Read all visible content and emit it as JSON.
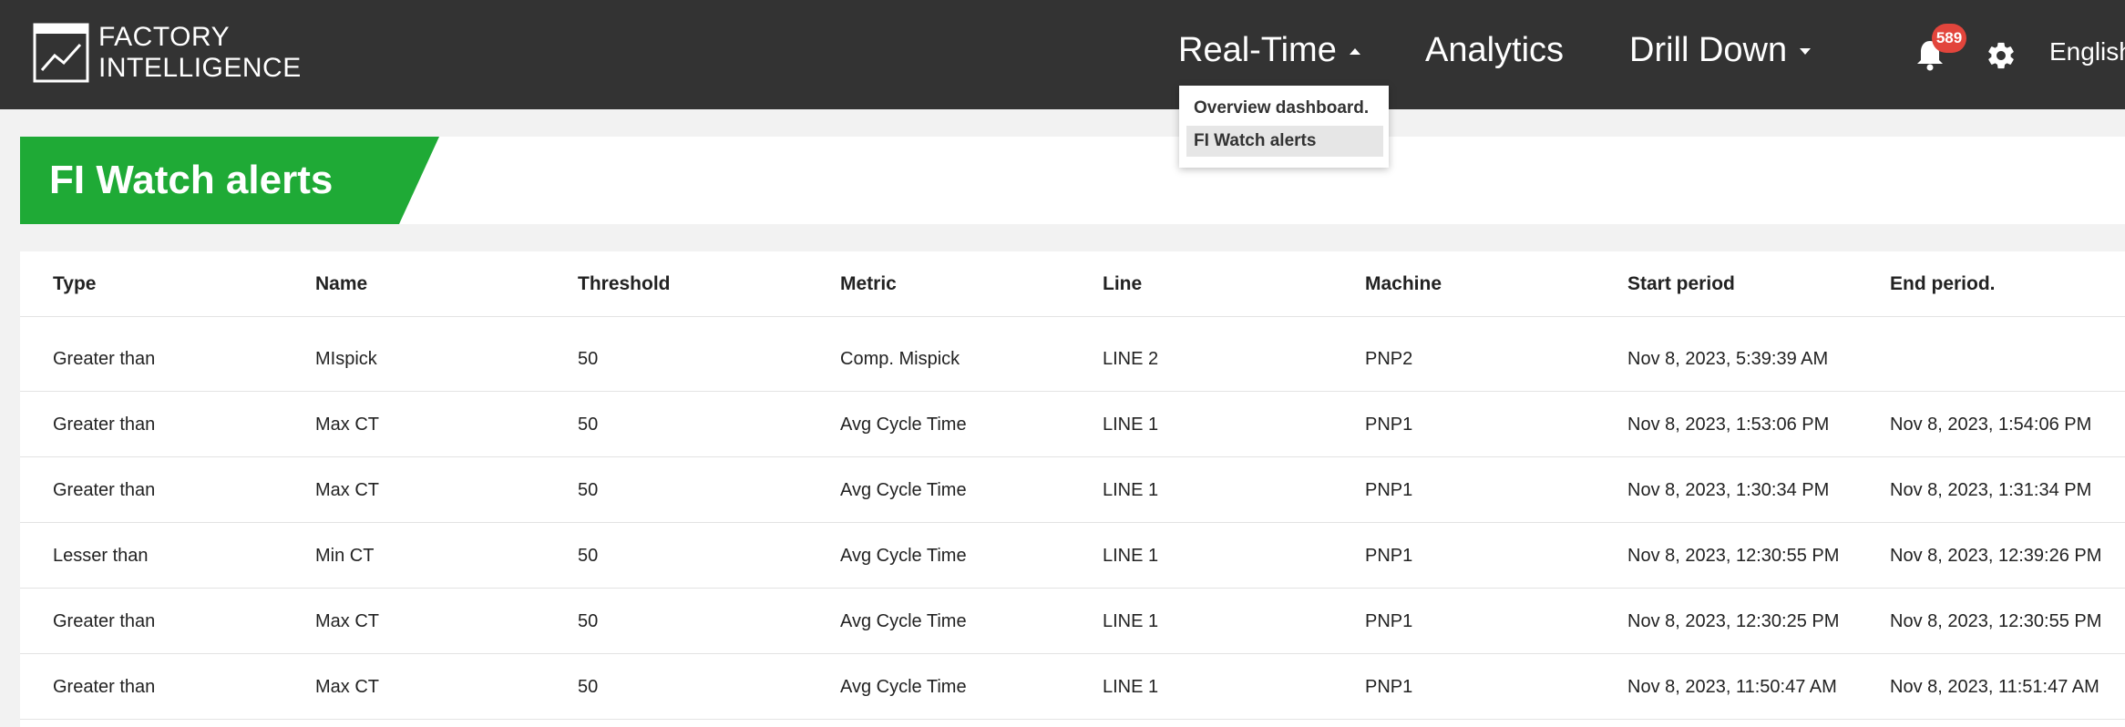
{
  "brand": {
    "line1": "FACTORY",
    "line2": "INTELLIGENCE",
    "logo_icon": "line-chart-logo-icon"
  },
  "nav": {
    "realtime": "Real-Time",
    "analytics": "Analytics",
    "drilldown": "Drill Down",
    "realtime_caret_icon": "caret-up-icon",
    "drilldown_caret_icon": "caret-down-icon"
  },
  "notifications": {
    "icon": "bell-icon",
    "count": "589",
    "badge_color": "#e2453c"
  },
  "settings": {
    "icon": "gear-icon"
  },
  "language": "English",
  "dropdown": {
    "items": [
      {
        "label": "Overview dashboard."
      },
      {
        "label": "FI Watch alerts"
      }
    ],
    "selected": "FI Watch alerts"
  },
  "page": {
    "title": "FI Watch alerts",
    "accent_color": "#1faa36",
    "topbar_color": "#333333"
  },
  "table": {
    "headers": [
      "Type",
      "Name",
      "Threshold",
      "Metric",
      "Line",
      "Machine",
      "Start period",
      "End period."
    ],
    "rows": [
      [
        "Greater than",
        "MIspick",
        "50",
        "Comp. Mispick",
        "LINE 2",
        "PNP2",
        "Nov 8, 2023, 5:39:39 AM",
        ""
      ],
      [
        "Greater than",
        "Max CT",
        "50",
        "Avg Cycle Time",
        "LINE 1",
        "PNP1",
        "Nov 8, 2023, 1:53:06 PM",
        "Nov 8, 2023, 1:54:06 PM"
      ],
      [
        "Greater than",
        "Max CT",
        "50",
        "Avg Cycle Time",
        "LINE 1",
        "PNP1",
        "Nov 8, 2023, 1:30:34 PM",
        "Nov 8, 2023, 1:31:34 PM"
      ],
      [
        "Lesser than",
        "Min CT",
        "50",
        "Avg Cycle Time",
        "LINE 1",
        "PNP1",
        "Nov 8, 2023, 12:30:55 PM",
        "Nov 8, 2023, 12:39:26 PM"
      ],
      [
        "Greater than",
        "Max CT",
        "50",
        "Avg Cycle Time",
        "LINE 1",
        "PNP1",
        "Nov 8, 2023, 12:30:25 PM",
        "Nov 8, 2023, 12:30:55 PM"
      ],
      [
        "Greater than",
        "Max CT",
        "50",
        "Avg Cycle Time",
        "LINE 1",
        "PNP1",
        "Nov 8, 2023, 11:50:47 AM",
        "Nov 8, 2023, 11:51:47 AM"
      ]
    ]
  }
}
